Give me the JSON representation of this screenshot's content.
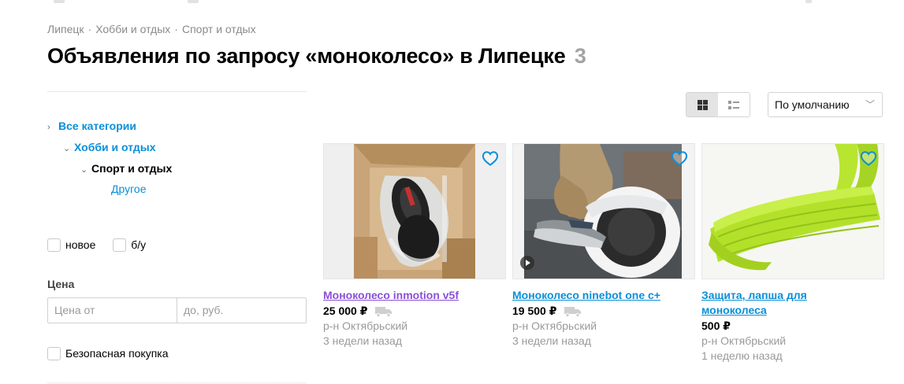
{
  "breadcrumb": {
    "items": [
      "Липецк",
      "Хобби и отдых",
      "Спорт и отдых"
    ],
    "separator": "·"
  },
  "header": {
    "title": "Объявления по запросу «моноколесо» в Липецке",
    "count": "3"
  },
  "sidebar": {
    "categories": {
      "all": "Все категории",
      "hobby": "Хобби и отдых",
      "sport": "Спорт и отдых",
      "other": "Другое"
    },
    "condition": {
      "new_label": "новое",
      "used_label": "б/у"
    },
    "price": {
      "label": "Цена",
      "from_placeholder": "Цена от",
      "to_placeholder": "до, руб."
    },
    "safe_purchase_label": "Безопасная покупка"
  },
  "toolbar": {
    "view_mode": "grid",
    "sort_label": "По умолчанию"
  },
  "colors": {
    "link": "#0a8fd8",
    "visited_link": "#8b4fd8",
    "muted": "#9a9a9a",
    "favorite": "#0a8fd8"
  },
  "listings": [
    {
      "title": "Моноколесо inmotion v5f",
      "price": "25 000 ₽",
      "district": "р-н Октябрьский",
      "age": "3 недели назад",
      "visited": true,
      "has_delivery": true,
      "has_video": false,
      "photo": "boxed monowheel in cardboard box"
    },
    {
      "title": "Моноколесо ninebot one c+",
      "price": "19 500 ₽",
      "district": "р-н Октябрьский",
      "age": "3 недели назад",
      "visited": false,
      "has_delivery": true,
      "has_video": true,
      "photo": "person riding white monowheel"
    },
    {
      "title": "Защита, лапша для моноколеса",
      "price": "500 ₽",
      "district": "р-н Октябрьский",
      "age": "1 неделю назад",
      "visited": false,
      "has_delivery": false,
      "has_video": false,
      "photo": "lime green foam protection pad"
    }
  ]
}
